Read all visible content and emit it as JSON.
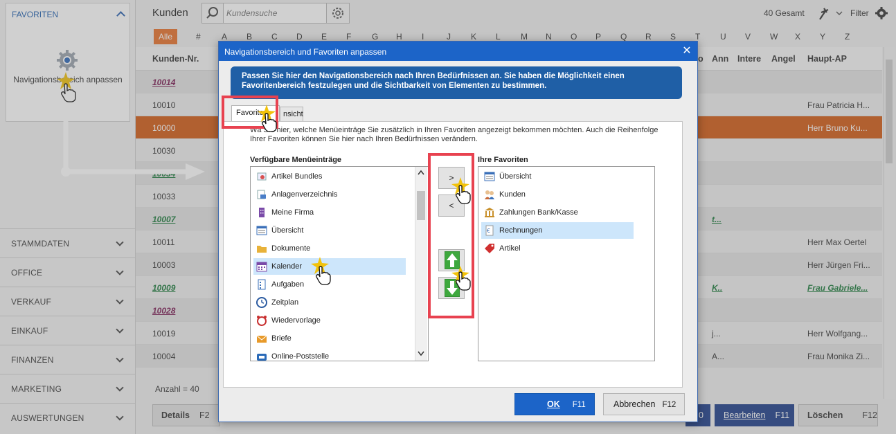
{
  "sidebar": {
    "favorites_title": "FAVORITEN",
    "nav_customize_label": "Navigationsbereich anpassen",
    "items": [
      {
        "label": "STAMMDATEN"
      },
      {
        "label": "OFFICE"
      },
      {
        "label": "VERKAUF"
      },
      {
        "label": "EINKAUF"
      },
      {
        "label": "FINANZEN"
      },
      {
        "label": "MARKETING"
      },
      {
        "label": "AUSWERTUNGEN"
      }
    ]
  },
  "header": {
    "title": "Kunden",
    "search_placeholder": "Kundensuche",
    "total": "40 Gesamt",
    "filter_label": "Filter"
  },
  "alphabet": {
    "all": "Alle",
    "letters": [
      "#",
      "A",
      "B",
      "C",
      "D",
      "E",
      "F",
      "G",
      "H",
      "I",
      "J",
      "K",
      "L",
      "M",
      "N",
      "O",
      "P",
      "Q",
      "R",
      "S",
      "T",
      "U",
      "V",
      "W",
      "X",
      "Y",
      "Z"
    ]
  },
  "table": {
    "columns": {
      "nr": "Kunden-Nr.",
      "partial": "o",
      "ann": "Ann",
      "inter": "Intere",
      "angel": "Angel",
      "haupt": "Haupt-AP"
    },
    "rows": [
      {
        "nr": "10014",
        "haupt": "",
        "extra": ""
      },
      {
        "nr": "10010",
        "haupt": "Frau Patricia H...",
        "extra": ""
      },
      {
        "nr": "10000",
        "haupt": "Herr Bruno Ku...",
        "extra": ""
      },
      {
        "nr": "10030",
        "haupt": "",
        "extra": ""
      },
      {
        "nr": "10034",
        "haupt": "",
        "extra": ""
      },
      {
        "nr": "10033",
        "haupt": "",
        "extra": ""
      },
      {
        "nr": "10007",
        "haupt": "",
        "extra": "t..."
      },
      {
        "nr": "10011",
        "haupt": "Herr Max Oertel",
        "extra": ""
      },
      {
        "nr": "10003",
        "haupt": "Herr Jürgen Fri...",
        "extra": ""
      },
      {
        "nr": "10009",
        "haupt": "Frau Gabriele...",
        "extra": "K.."
      },
      {
        "nr": "10028",
        "haupt": "",
        "extra": ""
      },
      {
        "nr": "10019",
        "haupt": "Herr Wolfgang...",
        "extra": "j..."
      },
      {
        "nr": "10004",
        "haupt": "Frau Monika Zi...",
        "extra": "A..."
      }
    ]
  },
  "footer": {
    "count": "Anzahl = 40",
    "details_label": "Details",
    "details_key": "F2",
    "hidden_key": "0",
    "edit_label": "Bearbeiten",
    "edit_key": "F11",
    "delete_label": "Löschen",
    "delete_key": "F12"
  },
  "dialog": {
    "title": "Navigationsbereich und Favoriten anpassen",
    "info_line1": "Passen Sie hier den Navigationsbereich nach Ihren Bedürfnissen an. Sie haben die Möglichkeit einen",
    "info_line2": "Favoritenbereich festzulegen und die Sichtbarkeit von Elementen zu bestimmen.",
    "tab_favorites": "Favoriten",
    "tab_view": "nsicht",
    "hint_line1": "Wä     Sie hier, welche Menüeinträge Sie zusätzlich in Ihren Favoriten angezeigt bekommen möchten. Auch die Reihenfolge",
    "hint_line2": "Ihrer Favoriten können Sie hier nach Ihren Bedürfnissen verändern.",
    "available_title": "Verfügbare Menüeinträge",
    "favorites_title": "Ihre Favoriten",
    "available_items": [
      {
        "label": "Artikel Bundles",
        "icon": "bundle-icon",
        "color": "#d85050"
      },
      {
        "label": "Anlagenverzeichnis",
        "icon": "asset-icon",
        "color": "#4a7ec8"
      },
      {
        "label": "Meine Firma",
        "icon": "building-icon",
        "color": "#7a4aa8"
      },
      {
        "label": "Übersicht",
        "icon": "overview-icon",
        "color": "#3a6fb8"
      },
      {
        "label": "Dokumente",
        "icon": "folder-icon",
        "color": "#e8b23a"
      },
      {
        "label": "Kalender",
        "icon": "calendar-icon",
        "color": "#7a4aa8"
      },
      {
        "label": "Aufgaben",
        "icon": "tasks-icon",
        "color": "#3a6fb8"
      },
      {
        "label": "Zeitplan",
        "icon": "clock-icon",
        "color": "#2a5aa0"
      },
      {
        "label": "Wiedervorlage",
        "icon": "alarm-icon",
        "color": "#c83030"
      },
      {
        "label": "Briefe",
        "icon": "letter-icon",
        "color": "#e89a2a"
      },
      {
        "label": "Online-Poststelle",
        "icon": "mailbox-icon",
        "color": "#2a6ab8"
      }
    ],
    "favorite_items": [
      {
        "label": "Übersicht",
        "icon": "overview-icon",
        "color": "#3a6fb8"
      },
      {
        "label": "Kunden",
        "icon": "customers-icon",
        "color": "#c86a3a"
      },
      {
        "label": "Zahlungen Bank/Kasse",
        "icon": "bank-icon",
        "color": "#c8902a"
      },
      {
        "label": "Rechnungen",
        "icon": "invoice-icon",
        "color": "#3a6fb8"
      },
      {
        "label": "Artikel",
        "icon": "tag-icon",
        "color": "#d03030"
      }
    ],
    "add_label": ">",
    "remove_label": "<",
    "ok_label": "OK",
    "ok_key": "F11",
    "cancel_label": "Abbrechen",
    "cancel_key": "F12"
  },
  "colors": {
    "accent": "#1c64c8",
    "selection": "#d25a14",
    "highlight": "#e84250"
  }
}
